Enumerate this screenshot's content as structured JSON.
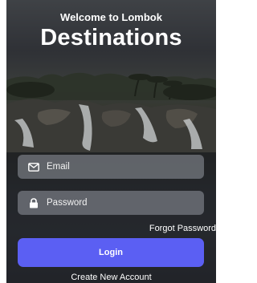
{
  "header": {
    "subtitle": "Welcome to Lombok",
    "title": "Destinations"
  },
  "form": {
    "email_placeholder": "Email",
    "password_placeholder": "Password",
    "forgot_label": "Forgot Password",
    "login_label": "Login",
    "create_account_label": "Create New Account"
  },
  "colors": {
    "accent": "#5b5ff3",
    "field_bg": "#787d84"
  },
  "icons": {
    "email": "mail-icon",
    "password": "lock-icon"
  }
}
